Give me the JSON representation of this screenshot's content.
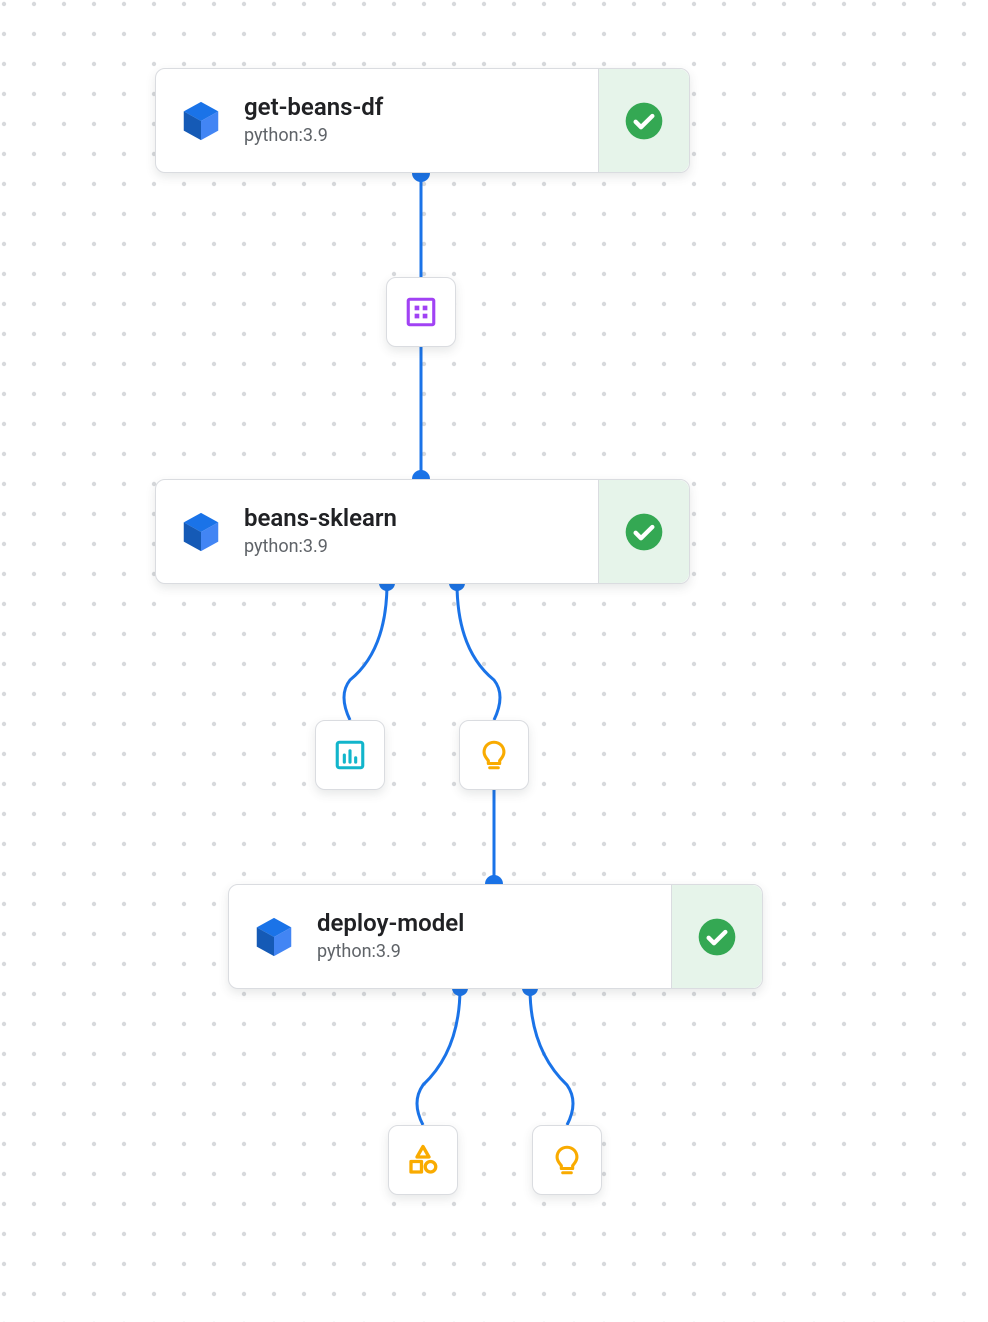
{
  "colors": {
    "edge": "#1a73e8",
    "dot": "#d7d9dc",
    "status_ok_bg": "#34a853",
    "status_ok_fg": "#ffffff",
    "cube": "#1a73e8",
    "dataset_icon": "#a142f4",
    "metrics_icon": "#12b5cb",
    "model_icon": "#f9ab00",
    "shapes_icon": "#f9ab00"
  },
  "nodes": [
    {
      "id": "get-beans-df",
      "title": "get-beans-df",
      "subtitle": "python:3.9",
      "status": "success"
    },
    {
      "id": "beans-sklearn",
      "title": "beans-sklearn",
      "subtitle": "python:3.9",
      "status": "success"
    },
    {
      "id": "deploy-model",
      "title": "deploy-model",
      "subtitle": "python:3.9",
      "status": "success"
    }
  ],
  "artifacts": [
    {
      "id": "dataset",
      "icon": "dataset"
    },
    {
      "id": "metrics",
      "icon": "metrics"
    },
    {
      "id": "model1",
      "icon": "model"
    },
    {
      "id": "shapes",
      "icon": "shapes"
    },
    {
      "id": "model2",
      "icon": "model"
    }
  ]
}
